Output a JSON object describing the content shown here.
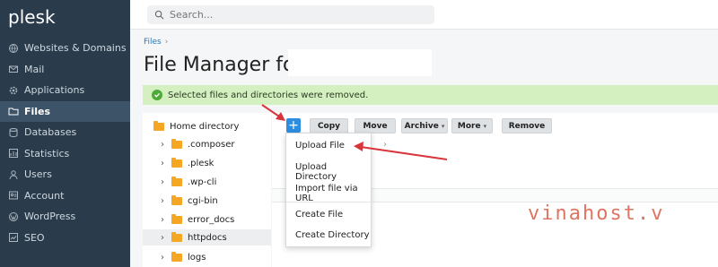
{
  "app": {
    "logo": "plesk"
  },
  "sidebar": {
    "items": [
      {
        "label": "Websites & Domains",
        "icon": "globe-icon"
      },
      {
        "label": "Mail",
        "icon": "mail-icon"
      },
      {
        "label": "Applications",
        "icon": "gear-icon"
      },
      {
        "label": "Files",
        "icon": "folder-icon",
        "active": true
      },
      {
        "label": "Databases",
        "icon": "database-icon"
      },
      {
        "label": "Statistics",
        "icon": "chart-icon"
      },
      {
        "label": "Users",
        "icon": "user-icon"
      },
      {
        "label": "Account",
        "icon": "account-icon"
      },
      {
        "label": "WordPress",
        "icon": "wordpress-icon"
      },
      {
        "label": "SEO",
        "icon": "seo-icon"
      }
    ],
    "collapse_glyph": "‹"
  },
  "search": {
    "placeholder": "Search..."
  },
  "breadcrumb": {
    "item": "Files",
    "sep": "›"
  },
  "page": {
    "title": "File Manager for"
  },
  "alert": {
    "text": "Selected files and directories were removed."
  },
  "tree": {
    "root": "Home directory",
    "items": [
      ".composer",
      ".plesk",
      ".wp-cli",
      "cgi-bin",
      "error_docs",
      "httpdocs",
      "logs"
    ]
  },
  "toolbar": {
    "add": "+",
    "copy": "Copy",
    "move": "Move",
    "archive": "Archive",
    "more": "More",
    "remove": "Remove"
  },
  "dropdown": {
    "upload_file": "Upload File",
    "upload_directory": "Upload Directory",
    "import_url": "Import file via URL",
    "create_file": "Create File",
    "create_directory": "Create Directory"
  },
  "watermark": "vinahost.v",
  "colors": {
    "sidebar": "#2a3b4b",
    "accent": "#2d8de0",
    "alert_bg": "#d4f0c1",
    "arrow": "#d9343a"
  }
}
